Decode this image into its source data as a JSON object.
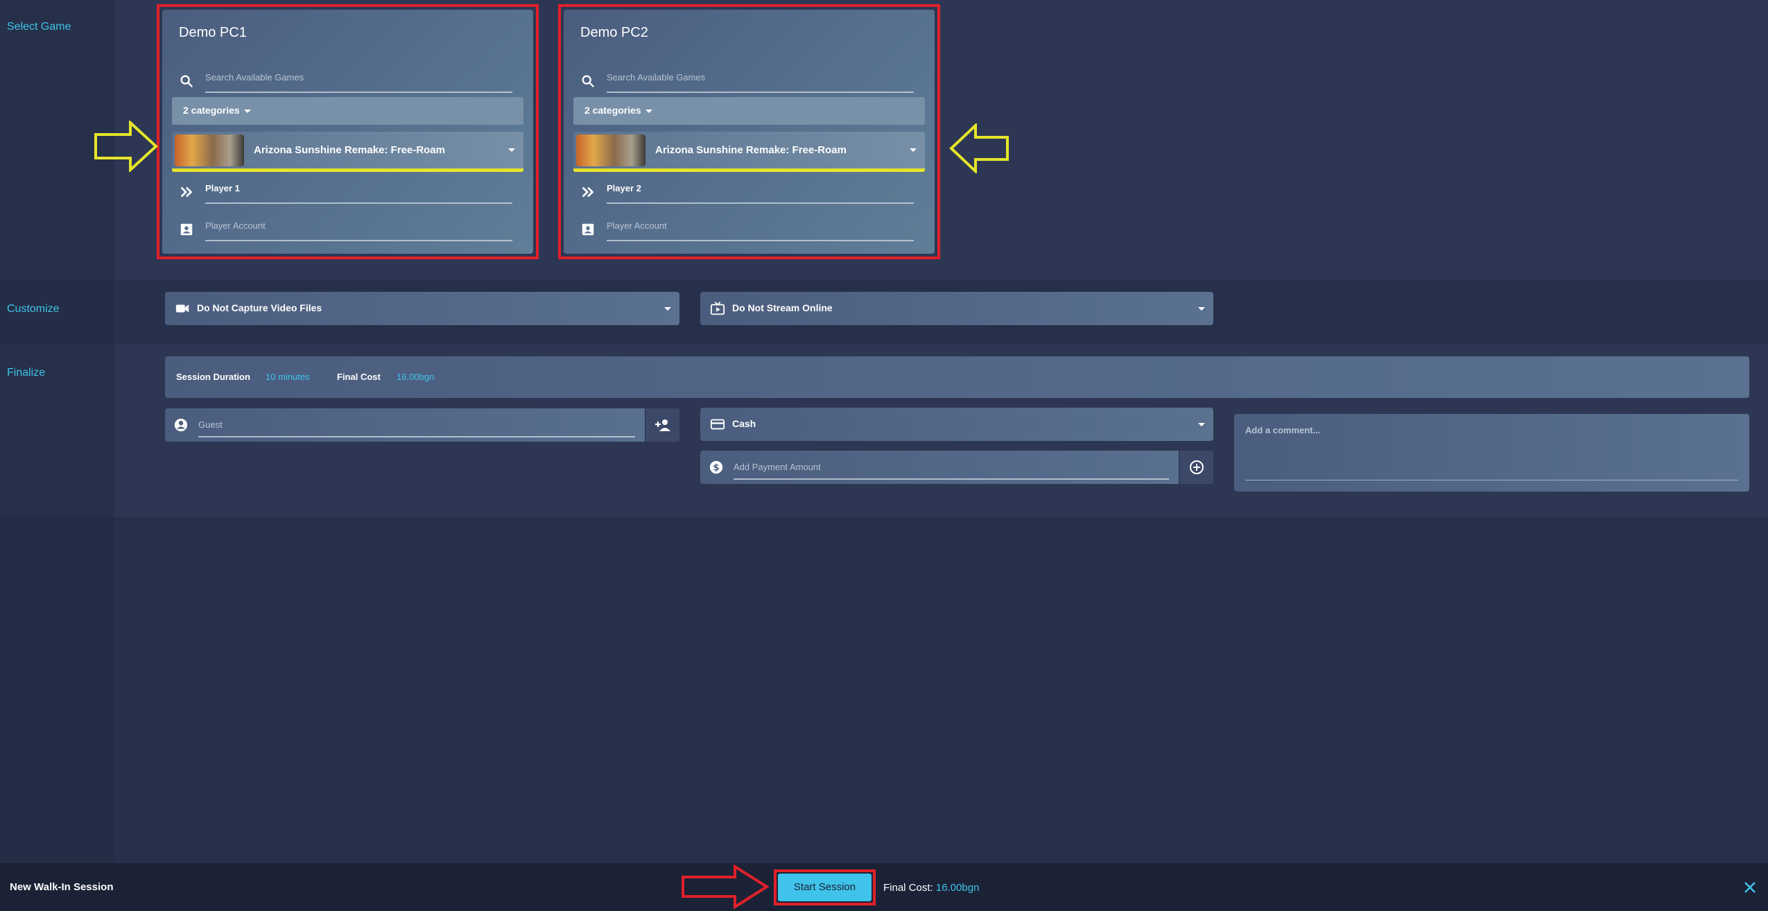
{
  "sections": {
    "select_game": "Select Game",
    "customize": "Customize",
    "finalize": "Finalize"
  },
  "pcs": [
    {
      "title": "Demo PC1",
      "search_placeholder": "Search Available Games",
      "categories": "2 categories",
      "game": "Arizona Sunshine Remake: Free-Roam",
      "player": "Player 1",
      "account_placeholder": "Player Account"
    },
    {
      "title": "Demo PC2",
      "search_placeholder": "Search Available Games",
      "categories": "2 categories",
      "game": "Arizona Sunshine Remake: Free-Roam",
      "player": "Player 2",
      "account_placeholder": "Player Account"
    }
  ],
  "customize": {
    "video": "Do Not Capture Video Files",
    "stream": "Do Not Stream Online"
  },
  "finalize": {
    "duration_label": "Session Duration",
    "duration_value": "10 minutes",
    "cost_label": "Final Cost",
    "cost_value": "16.00bgn",
    "guest_placeholder": "Guest",
    "payment_method": "Cash",
    "payment_amount_placeholder": "Add Payment Amount",
    "comment_placeholder": "Add a comment..."
  },
  "footer": {
    "title": "New Walk-In Session",
    "start_label": "Start Session",
    "cost_label": "Final Cost:",
    "cost_value": "16.00bgn"
  },
  "colors": {
    "accent": "#3fc3ea",
    "highlight_red": "#e0202a",
    "highlight_yellow": "#e6e52a",
    "background": "#27304a"
  }
}
